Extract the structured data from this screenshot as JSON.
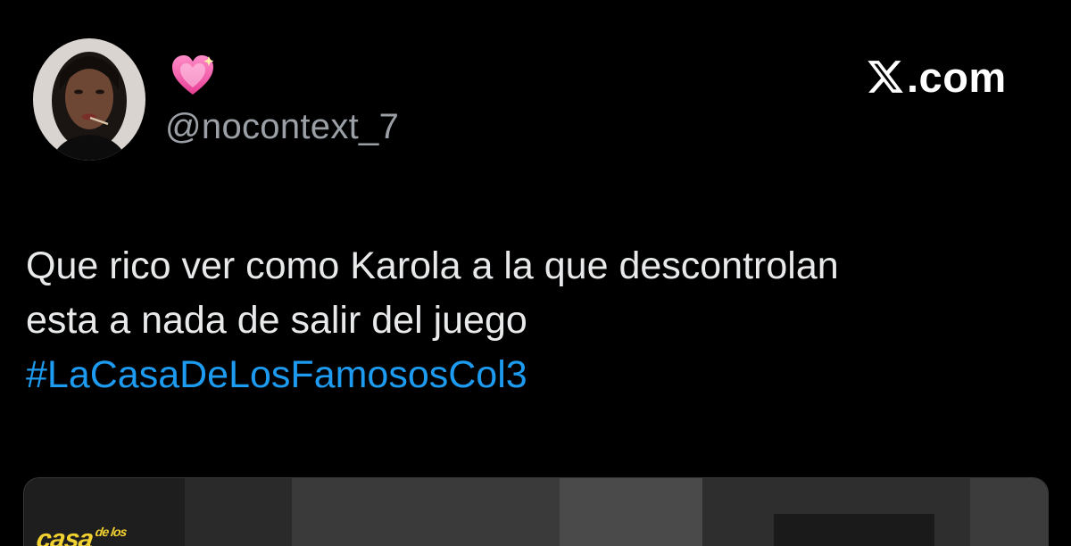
{
  "profile": {
    "display_name_icon": "pink-sparkling-heart-icon",
    "handle": "@nocontext_7",
    "avatar_icon": "profile-photo"
  },
  "brand": {
    "text": ".com",
    "logo_icon": "x-logo-icon"
  },
  "tweet": {
    "lines": [
      "Que rico ver como Karola a la que descontrolan",
      "esta a nada de salir del juego"
    ],
    "hashtag": "#LaCasaDeLosFamososCol3"
  },
  "media": {
    "logo_text": "casa",
    "logo_small": "de los"
  },
  "colors": {
    "background": "#000000",
    "text": "#e7e9ea",
    "secondary_text": "#9aa0a6",
    "hashtag": "#1d9bf0",
    "heart": "#f25aa8"
  }
}
